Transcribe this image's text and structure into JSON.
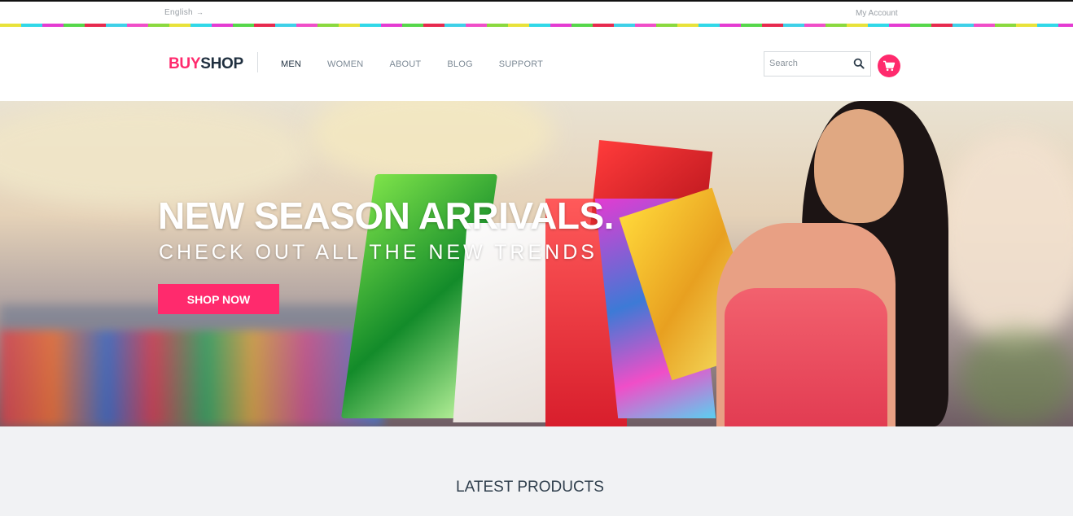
{
  "topbar": {
    "language": "English",
    "language_caret": "→",
    "account_link": "My Account"
  },
  "header": {
    "logo_part1": "BUY",
    "logo_part2": "SHOP",
    "nav": [
      {
        "label": "MEN",
        "active": true
      },
      {
        "label": "WOMEN",
        "active": false
      },
      {
        "label": "ABOUT",
        "active": false
      },
      {
        "label": "BLOG",
        "active": false
      },
      {
        "label": "SUPPORT",
        "active": false
      }
    ],
    "search_placeholder": "Search",
    "search_icon": "search-icon",
    "cart_icon": "cart-icon"
  },
  "hero": {
    "title": "NEW SEASON ARRIVALS.",
    "subtitle": "CHECK OUT ALL THE NEW TRENDS",
    "button_label": "SHOP NOW"
  },
  "latest": {
    "heading": "LATEST PRODUCTS"
  },
  "colors": {
    "accent": "#ff2a6d",
    "dark": "#1f2f3f",
    "muted": "#7d8a96",
    "section_bg": "#f1f2f4"
  }
}
